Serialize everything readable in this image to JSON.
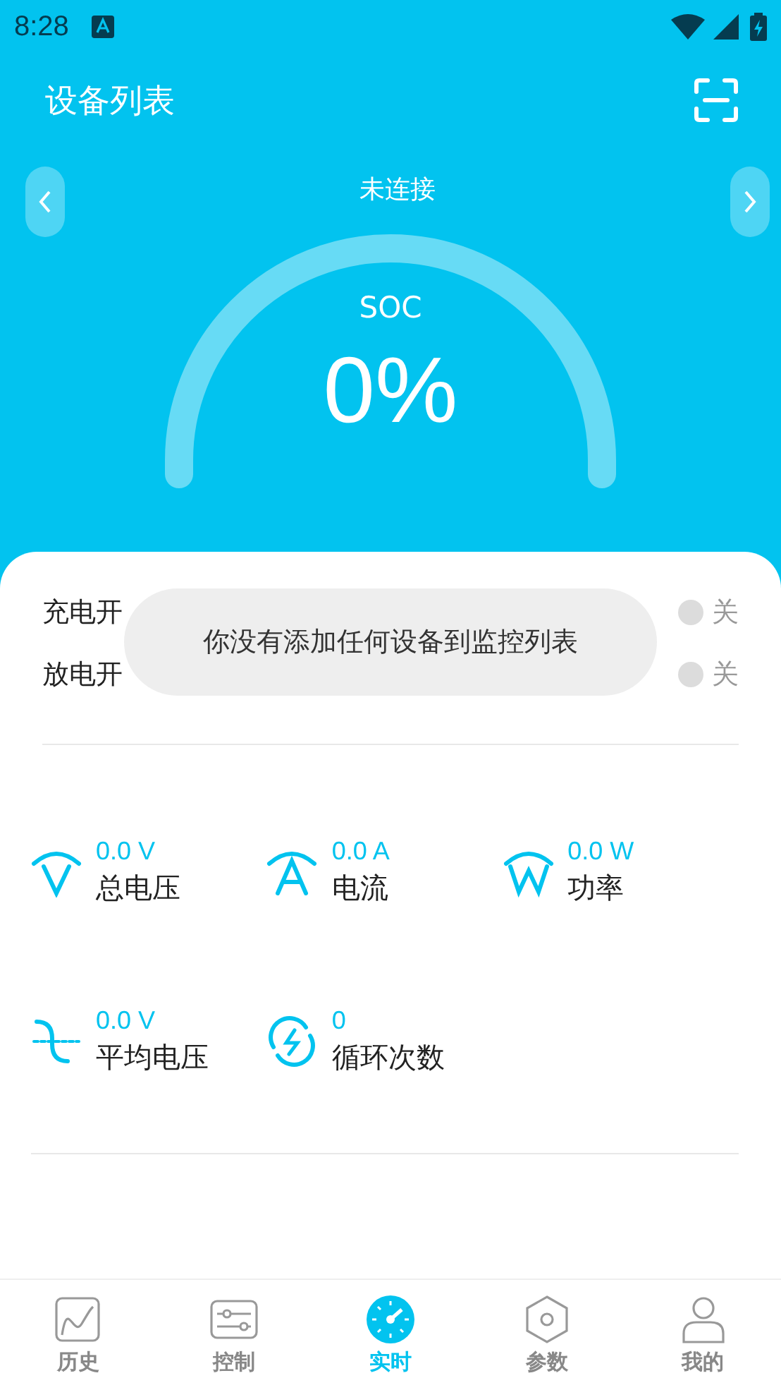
{
  "status_bar": {
    "time": "8:28"
  },
  "header": {
    "title": "设备列表"
  },
  "device": {
    "connection": "未连接"
  },
  "gauge": {
    "label": "SOC",
    "value": "0%"
  },
  "switches": [
    {
      "label": "充电开"
    },
    {
      "state": "关",
      "on": false
    },
    {
      "label": "放电开"
    },
    {
      "state": "关",
      "on": false
    }
  ],
  "toast": "你没有添加任何设备到监控列表",
  "metrics": [
    {
      "kind": "voltage",
      "value": "0.0 V",
      "label": "总电压"
    },
    {
      "kind": "current",
      "value": "0.0 A",
      "label": "电流"
    },
    {
      "kind": "power",
      "value": "0.0 W",
      "label": "功率"
    },
    {
      "kind": "average",
      "value": "0.0 V",
      "label": "平均电压"
    },
    {
      "kind": "cycles",
      "value": "0",
      "label": "循环次数"
    }
  ],
  "nav": [
    {
      "kind": "history",
      "label": "历史",
      "selected": false
    },
    {
      "kind": "control",
      "label": "控制",
      "selected": false
    },
    {
      "kind": "realtime",
      "label": "实时",
      "selected": true
    },
    {
      "kind": "params",
      "label": "参数",
      "selected": false
    },
    {
      "kind": "mine",
      "label": "我的",
      "selected": false
    }
  ]
}
